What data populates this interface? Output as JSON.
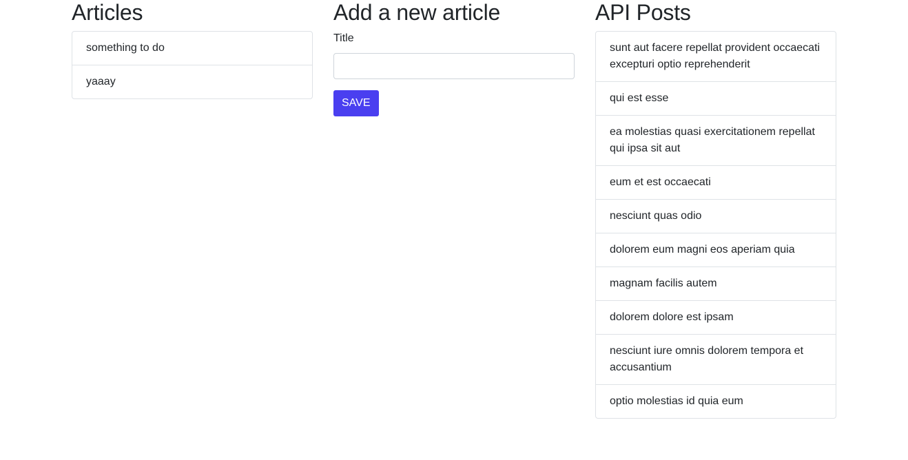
{
  "articles": {
    "heading": "Articles",
    "items": [
      "something to do",
      "yaaay"
    ]
  },
  "form": {
    "heading": "Add a new article",
    "title_label": "Title",
    "title_value": "",
    "title_placeholder": "",
    "save_label": "SAVE",
    "accent_color": "#4a3ff0"
  },
  "posts": {
    "heading": "API Posts",
    "items": [
      "sunt aut facere repellat provident occaecati excepturi optio reprehenderit",
      "qui est esse",
      "ea molestias quasi exercitationem repellat qui ipsa sit aut",
      "eum et est occaecati",
      "nesciunt quas odio",
      "dolorem eum magni eos aperiam quia",
      "magnam facilis autem",
      "dolorem dolore est ipsam",
      "nesciunt iure omnis dolorem tempora et accusantium",
      "optio molestias id quia eum"
    ]
  }
}
